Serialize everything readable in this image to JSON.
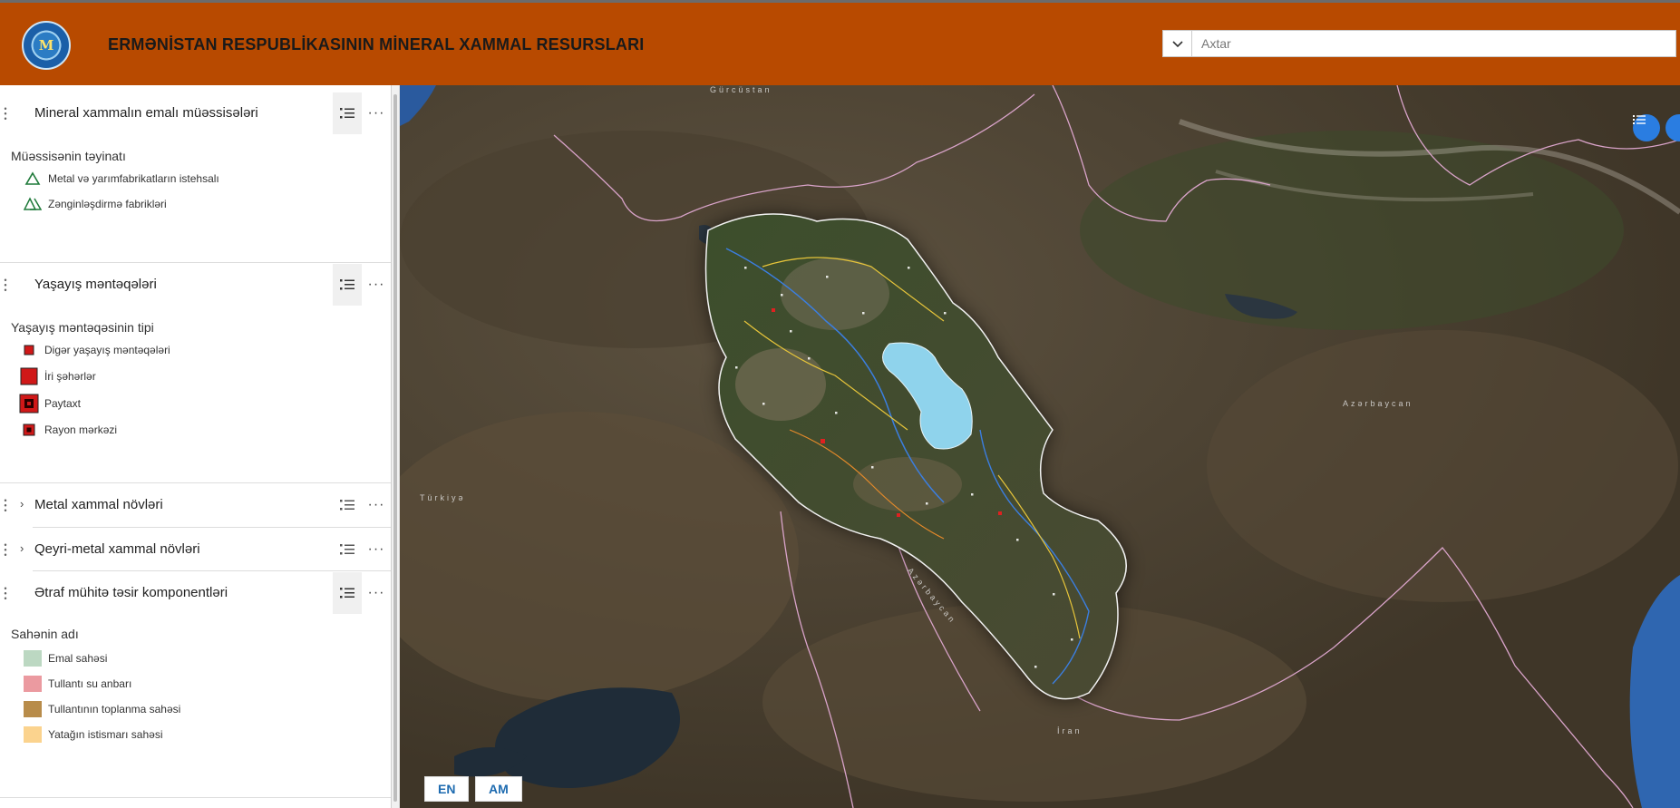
{
  "header": {
    "title": "ERMƏNİSTAN RESPUBLİKASININ MİNERAL XAMMAL RESURSLARI",
    "logo_text": "M",
    "background_color": "#b84a00"
  },
  "search": {
    "placeholder": "Axtar",
    "dropdown_icon": "chevron-down-icon"
  },
  "layers": [
    {
      "title": "Mineral xammalın emalı müəssisələri",
      "legend_title": "Müəssisənin təyinatı",
      "items": [
        {
          "label": "Metal və yarımfabrikatların istehsalı",
          "symbol": "triangle-outline-icon"
        },
        {
          "label": "Zənginləşdirmə fabrikləri",
          "symbol": "double-triangle-icon"
        }
      ]
    },
    {
      "title": "Yaşayış məntəqələri",
      "legend_title": "Yaşayış məntəqəsinin tipi",
      "items": [
        {
          "label": "Digər yaşayış məntəqələri",
          "symbol": "small-red-square-icon"
        },
        {
          "label": "İri şəhərlər",
          "symbol": "large-red-square-icon"
        },
        {
          "label": "Paytaxt",
          "symbol": "capital-square-icon"
        },
        {
          "label": "Rayon mərkəzi",
          "symbol": "district-center-icon"
        }
      ]
    },
    {
      "title": "Metal xammal növləri"
    },
    {
      "title": "Qeyri-metal xammal növləri"
    },
    {
      "title": "Ətraf mühitə təsir komponentləri",
      "legend_title": "Sahənin adı",
      "items": [
        {
          "label": "Emal sahəsi",
          "color": "#bcd8c2"
        },
        {
          "label": "Tullantı su anbarı",
          "color": "#eb9aa0"
        },
        {
          "label": "Tullantının toplanma sahəsi",
          "color": "#b88c4a"
        },
        {
          "label": "Yatağın istismarı sahəsi",
          "color": "#fbd38e"
        }
      ]
    }
  ],
  "map": {
    "labels": [
      "Gürcüstan",
      "Azərbaycan",
      "Türkiyə",
      "Azərbaycan",
      "İran"
    ],
    "lake_color": "#8fd3ec",
    "border_color": "#d9a3c9"
  },
  "language_buttons": [
    "EN",
    "AM"
  ]
}
